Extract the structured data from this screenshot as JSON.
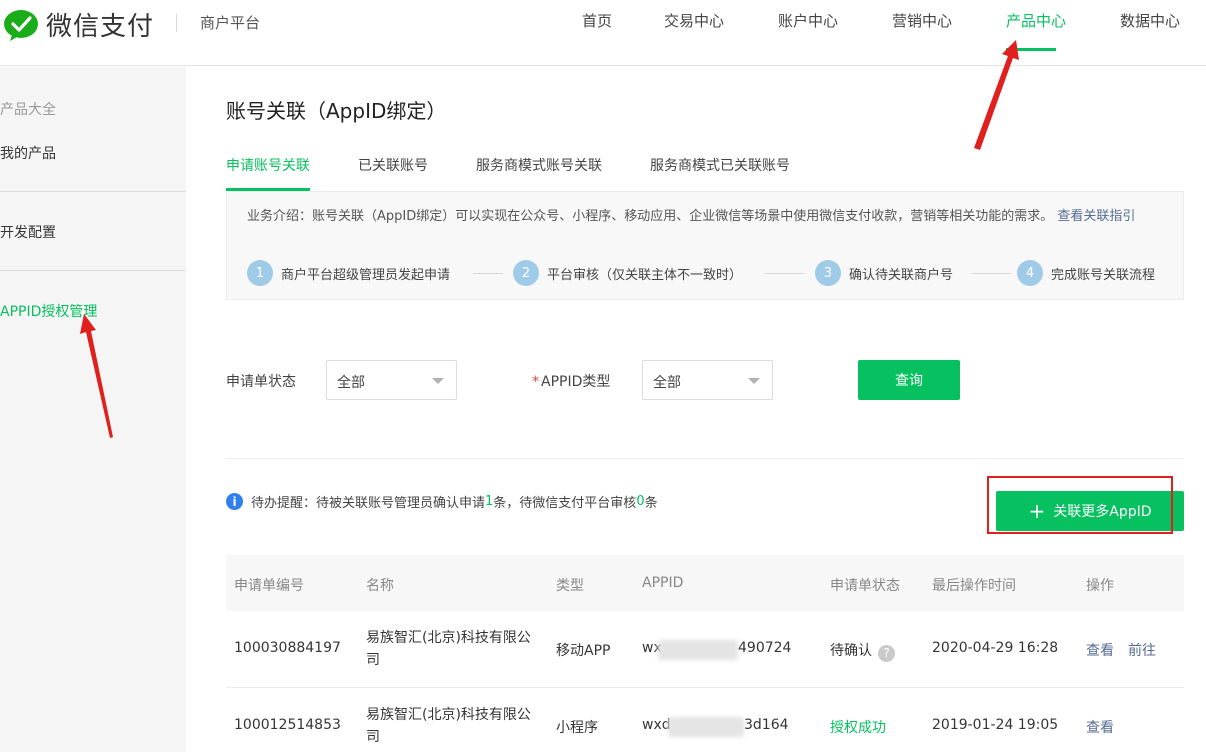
{
  "header": {
    "brand": "微信支付",
    "platform": "商户平台",
    "nav": [
      {
        "label": "首页"
      },
      {
        "label": "交易中心"
      },
      {
        "label": "账户中心"
      },
      {
        "label": "营销中心"
      },
      {
        "label": "产品中心",
        "active": true
      },
      {
        "label": "数据中心"
      }
    ]
  },
  "sidebar": {
    "group_title": "产品大全",
    "items": [
      {
        "label": "我的产品"
      },
      {
        "label": "开发配置"
      },
      {
        "label": "APPID授权管理",
        "active": true
      }
    ]
  },
  "main": {
    "title": "账号关联（AppID绑定）",
    "tabs": [
      {
        "label": "申请账号关联",
        "active": true
      },
      {
        "label": "已关联账号"
      },
      {
        "label": "服务商模式账号关联"
      },
      {
        "label": "服务商模式已关联账号"
      }
    ],
    "intro": {
      "text": "业务介绍：账号关联（AppID绑定）可以实现在公众号、小程序、移动应用、企业微信等场景中使用微信支付收款，营销等相关功能的需求。",
      "link": "查看关联指引",
      "steps": [
        {
          "num": "1",
          "label": "商户平台超级管理员发起申请"
        },
        {
          "num": "2",
          "label": "平台审核（仅关联主体不一致时）"
        },
        {
          "num": "3",
          "label": "确认待关联商户号"
        },
        {
          "num": "4",
          "label": "完成账号关联流程"
        }
      ]
    },
    "filter": {
      "status_label": "申请单状态",
      "status_value": "全部",
      "type_required": "*",
      "type_label": "APPID类型",
      "type_value": "全部",
      "query_button": "查询"
    },
    "notice": {
      "prefix": "待办提醒：待被关联账号管理员确认申请",
      "count1": "1",
      "middle": "条，待微信支付平台审核",
      "count2": "0",
      "suffix": "条"
    },
    "add_button": "关联更多AppID",
    "table": {
      "headers": [
        "申请单编号",
        "名称",
        "类型",
        "APPID",
        "申请单状态",
        "最后操作时间",
        "操作"
      ],
      "rows": [
        {
          "id": "100030884197",
          "name": "易族智汇(北京)科技有限公司",
          "type": "移动APP",
          "appid_prefix": "wx",
          "appid_suffix": "490724",
          "status": "待确认",
          "time": "2020-04-29 16:28",
          "actions": [
            "查看",
            "前往"
          ]
        },
        {
          "id": "100012514853",
          "name": "易族智汇(北京)科技有限公司",
          "type": "小程序",
          "appid_prefix": "wxd",
          "appid_suffix": "3d164",
          "status": "授权成功",
          "time": "2019-01-24 19:05",
          "actions": [
            "查看"
          ]
        }
      ]
    }
  },
  "colors": {
    "brand_green": "#07c160",
    "link_blue": "#576b95",
    "annotation_red": "#e0201c"
  }
}
